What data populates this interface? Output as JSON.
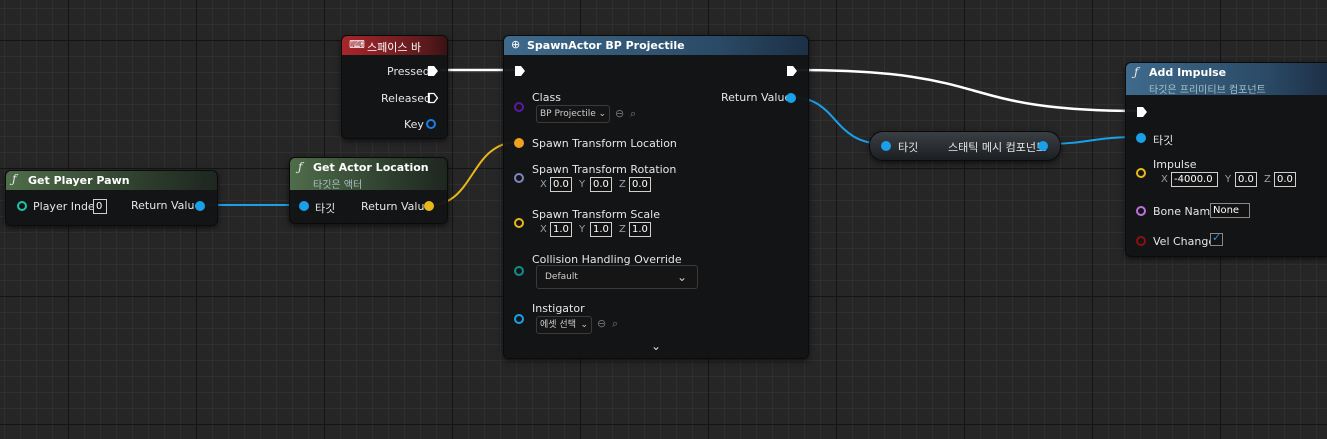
{
  "colors": {
    "exec": "#ffffff",
    "object": "#1aa0e8",
    "vector": "#e8b81a",
    "transform": "#f0a020",
    "struct": "#7f86c0",
    "byte": "#109088",
    "name": "#c070d8",
    "bool": "#8a1010",
    "class": "#5a1aa0",
    "int": "#20c4a8"
  },
  "get_player_pawn": {
    "title": "Get Player Pawn",
    "player_index_label": "Player Index",
    "player_index_value": "0",
    "return_label": "Return Value",
    "func_icon": "function-icon"
  },
  "get_actor_location": {
    "title": "Get Actor Location",
    "subtitle": "타깃은 액터",
    "target_label": "타깃",
    "return_label": "Return Value",
    "func_icon": "function-icon"
  },
  "spacebar": {
    "title": "스페이스 바",
    "icon": "keyboard-icon",
    "pressed_label": "Pressed",
    "released_label": "Released",
    "key_label": "Key"
  },
  "spawn_actor": {
    "title": "SpawnActor BP Projectile",
    "icon": "spawn-actor-icon",
    "class_label": "Class",
    "class_value": "BP Projectile",
    "return_label": "Return Value",
    "location_label": "Spawn Transform Location",
    "rotation_label": "Spawn Transform Rotation",
    "rotation": {
      "x": "0.0",
      "y": "0.0",
      "z": "0.0"
    },
    "scale_label": "Spawn Transform Scale",
    "scale": {
      "x": "1.0",
      "y": "1.0",
      "z": "1.0"
    },
    "collision_label": "Collision Handling Override",
    "collision_value": "Default",
    "instigator_label": "Instigator",
    "instigator_value": "에셋 선택",
    "axis_x": "X",
    "axis_y": "Y",
    "axis_z": "Z"
  },
  "cast_node": {
    "target_label": "타깃",
    "output_label": "스태틱 메시 컴포넌트"
  },
  "add_impulse": {
    "title": "Add Impulse",
    "subtitle": "타깃은 프리미티브 컴포넌트",
    "target_label": "타깃",
    "impulse_label": "Impulse",
    "impulse": {
      "x": "-4000.0",
      "y": "0.0",
      "z": "0.0"
    },
    "bone_label": "Bone Name",
    "bone_value": "None",
    "vel_label": "Vel Change",
    "vel_checked": true,
    "axis_x": "X",
    "axis_y": "Y",
    "axis_z": "Z",
    "func_icon": "function-icon"
  }
}
